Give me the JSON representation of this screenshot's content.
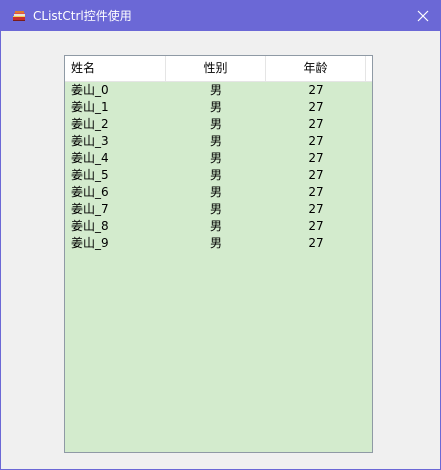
{
  "window": {
    "title": "CListCtrl控件使用",
    "titlebar_color": "#6b68d6",
    "app_icon": "app-books-icon",
    "close_icon": "close-icon"
  },
  "list": {
    "background_color": "#d3ebcd",
    "columns": [
      "姓名",
      "性别",
      "年龄"
    ],
    "rows": [
      [
        "姜山_0",
        "男",
        "27"
      ],
      [
        "姜山_1",
        "男",
        "27"
      ],
      [
        "姜山_2",
        "男",
        "27"
      ],
      [
        "姜山_3",
        "男",
        "27"
      ],
      [
        "姜山_4",
        "男",
        "27"
      ],
      [
        "姜山_5",
        "男",
        "27"
      ],
      [
        "姜山_6",
        "男",
        "27"
      ],
      [
        "姜山_7",
        "男",
        "27"
      ],
      [
        "姜山_8",
        "男",
        "27"
      ],
      [
        "姜山_9",
        "男",
        "27"
      ]
    ]
  }
}
